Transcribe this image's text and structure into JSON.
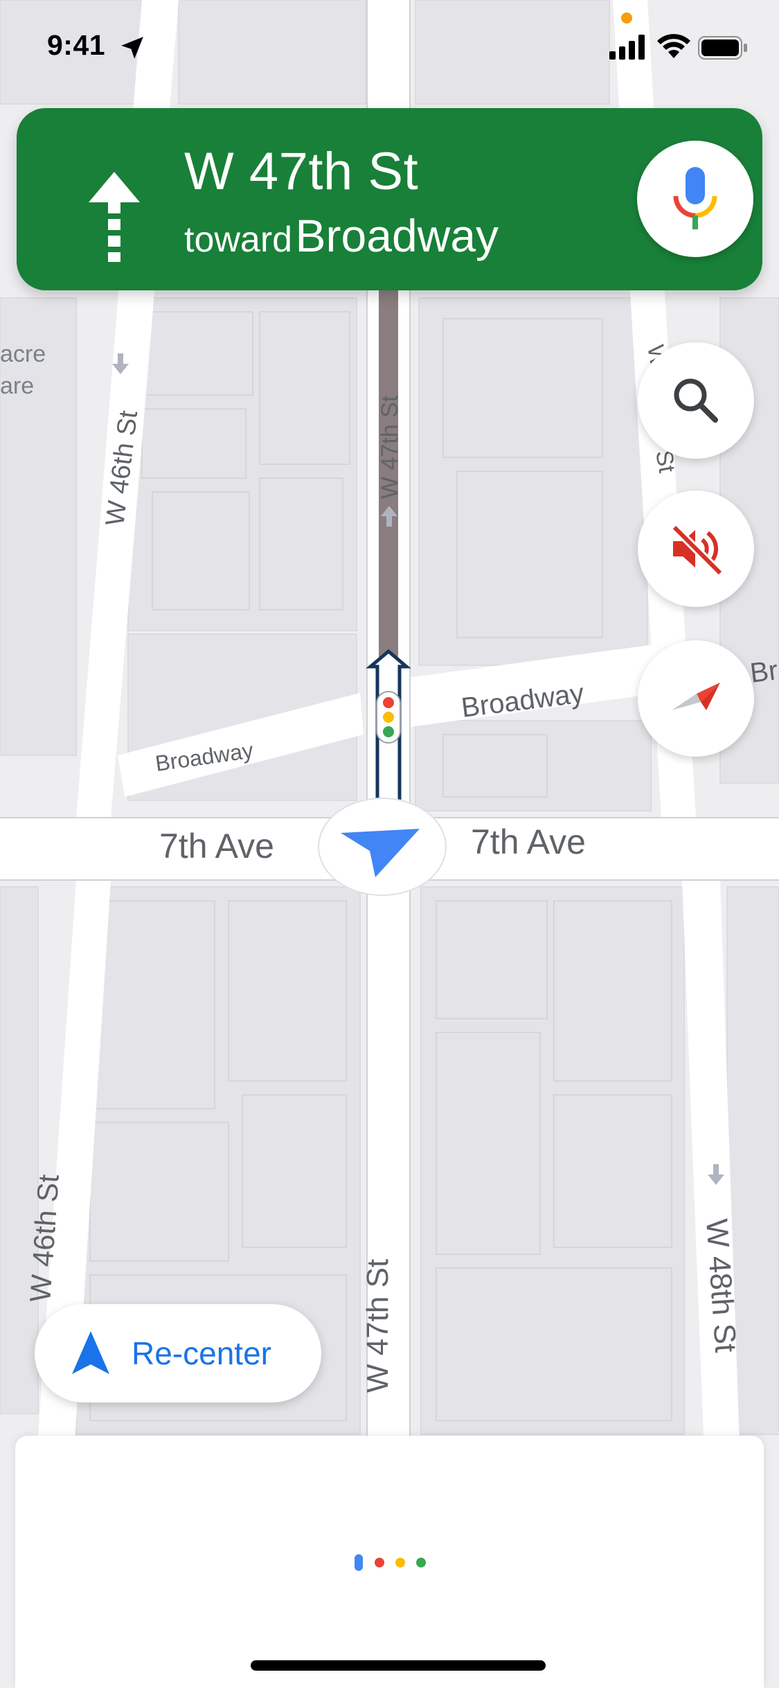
{
  "status_bar": {
    "time": "9:41",
    "icons": [
      "location-arrow-icon",
      "mic-in-use-dot",
      "cellular-signal-icon",
      "wifi-icon",
      "battery-icon"
    ]
  },
  "navigation": {
    "street": "W 47th St",
    "toward_word": "toward",
    "toward_street": "Broadway",
    "maneuver_icon": "straight-arrow-icon",
    "mic_icon": "google-mic-icon",
    "banner_color": "#188038"
  },
  "map": {
    "labels": {
      "w46_top": "W 46th St",
      "w47_top": "W 47th St",
      "w47_top_right_partial": "W",
      "w47_right_st": "St",
      "broadway_right": "Broadway",
      "broadway_left": "Broadway",
      "broadway_edge": "Br",
      "seventh_ave_left": "7th Ave",
      "seventh_ave_right": "7th Ave",
      "w46_bottom": "W 46th St",
      "w47_bottom": "W 47th St",
      "w48_bottom": "W 48th St",
      "acre_line1": "acre",
      "acre_line2": "are"
    },
    "route_color": "#1a73e8",
    "traffic_light_icon": "traffic-light-icon",
    "position_icon": "navigation-puck-icon"
  },
  "controls": {
    "search_icon": "search-icon",
    "mute_icon": "sound-off-icon",
    "compass_icon": "compass-icon",
    "recenter_label": "Re-center",
    "recenter_icon": "navigation-arrow-icon"
  },
  "bottom_sheet": {
    "loading_icon": "google-loading-dots",
    "dot_colors": [
      "#4285f4",
      "#ea4335",
      "#fbbc04",
      "#34a853"
    ]
  }
}
